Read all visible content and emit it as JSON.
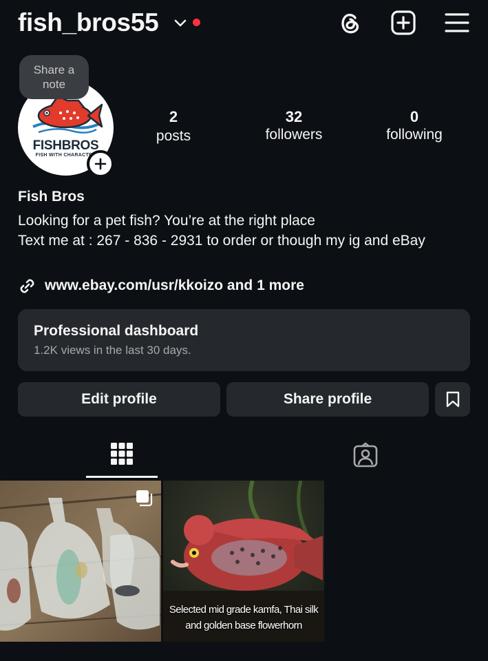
{
  "header": {
    "username": "fish_bros55",
    "icons": [
      "chevron-down-icon",
      "notification-dot",
      "threads-icon",
      "create-plus-icon",
      "menu-icon"
    ]
  },
  "profile": {
    "note_label": "Share a\nnote",
    "avatar_brand": "FISHBROS",
    "avatar_tagline": "FISH WITH CHARACTER",
    "stats": [
      {
        "value": "2",
        "label": "posts"
      },
      {
        "value": "32",
        "label": "followers"
      },
      {
        "value": "0",
        "label": "following"
      }
    ],
    "display_name": "Fish Bros",
    "bio_line1": "Looking for a pet fish? You’re at the right place",
    "bio_line2": "Text me at : 267 - 836 - 2931 to order or though my ig and eBay",
    "link_text": "www.ebay.com/usr/kkoizo and 1 more"
  },
  "dashboard": {
    "title": "Professional dashboard",
    "subtitle": "1.2K views in the last 30 days."
  },
  "actions": {
    "edit_label": "Edit profile",
    "share_label": "Share profile"
  },
  "tabs": [
    {
      "icon": "grid-icon",
      "active": true
    },
    {
      "icon": "tagged-icon",
      "active": false
    }
  ],
  "posts": [
    {
      "type": "carousel",
      "caption": ""
    },
    {
      "type": "image",
      "caption": "Selected mid grade kamfa, Thai silk\nand golden base flowerhorn"
    }
  ],
  "colors": {
    "background": "#0c1014",
    "surface": "#25292e",
    "notification": "#ff3040",
    "secondary_text": "#a8a8a8"
  }
}
